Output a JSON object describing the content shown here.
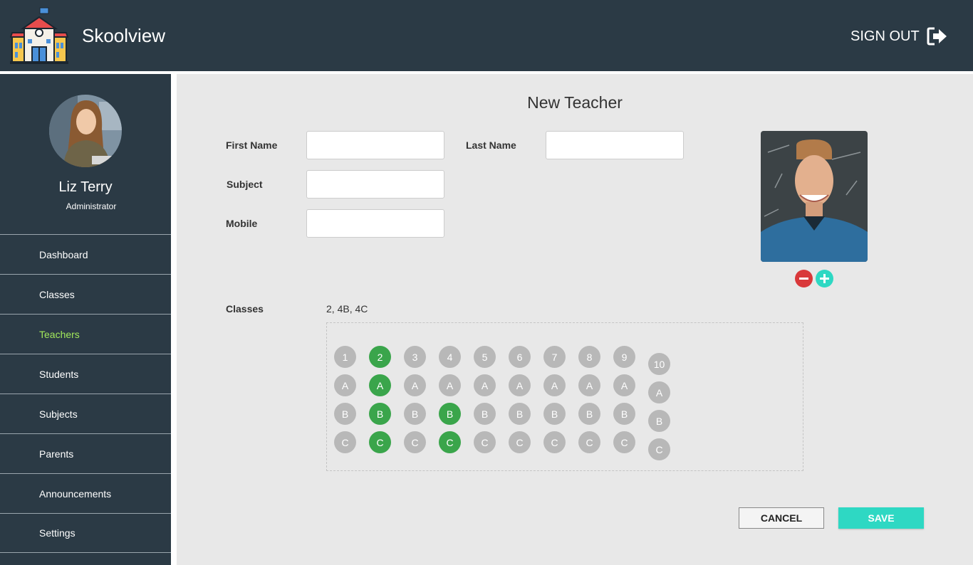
{
  "app": {
    "title": "Skoolview",
    "signout_label": "SIGN OUT"
  },
  "user": {
    "name": "Liz Terry",
    "role": "Administrator"
  },
  "sidebar": {
    "active": "Teachers",
    "items": [
      {
        "label": "Dashboard"
      },
      {
        "label": "Classes"
      },
      {
        "label": "Teachers"
      },
      {
        "label": "Students"
      },
      {
        "label": "Subjects"
      },
      {
        "label": "Parents"
      },
      {
        "label": "Announcements"
      },
      {
        "label": "Settings"
      }
    ]
  },
  "form": {
    "title": "New Teacher",
    "first_name_label": "First Name",
    "first_name_value": "",
    "last_name_label": "Last Name",
    "last_name_value": "",
    "subject_label": "Subject",
    "subject_value": "",
    "mobile_label": "Mobile",
    "mobile_value": "",
    "classes_label": "Classes",
    "classes_value": "2, 4B, 4C"
  },
  "class_grid": {
    "grades": [
      {
        "grade": "1",
        "sections": [
          "A",
          "B",
          "C"
        ],
        "selected": []
      },
      {
        "grade": "2",
        "sections": [
          "A",
          "B",
          "C"
        ],
        "selected": [
          "grade",
          "A",
          "B",
          "C"
        ]
      },
      {
        "grade": "3",
        "sections": [
          "A",
          "B",
          "C"
        ],
        "selected": []
      },
      {
        "grade": "4",
        "sections": [
          "A",
          "B",
          "C"
        ],
        "selected": [
          "B",
          "C"
        ]
      },
      {
        "grade": "5",
        "sections": [
          "A",
          "B",
          "C"
        ],
        "selected": []
      },
      {
        "grade": "6",
        "sections": [
          "A",
          "B",
          "C"
        ],
        "selected": []
      },
      {
        "grade": "7",
        "sections": [
          "A",
          "B",
          "C"
        ],
        "selected": []
      },
      {
        "grade": "8",
        "sections": [
          "A",
          "B",
          "C"
        ],
        "selected": []
      },
      {
        "grade": "9",
        "sections": [
          "A",
          "B",
          "C"
        ],
        "selected": []
      },
      {
        "grade": "10",
        "sections": [
          "A",
          "B",
          "C"
        ],
        "selected": []
      }
    ]
  },
  "buttons": {
    "cancel": "CANCEL",
    "save": "SAVE"
  },
  "colors": {
    "header": "#2b3a45",
    "sidebar": "#2b3a45",
    "active_nav": "#a2e85b",
    "chip_selected": "#3aa54b",
    "chip_default": "#b8b8b8",
    "accent": "#2ed8c3",
    "remove": "#d9383a"
  },
  "icons": {
    "logo": "school-building-icon",
    "signout": "sign-out-icon",
    "remove_photo": "minus-circle-icon",
    "add_photo": "plus-circle-icon"
  }
}
